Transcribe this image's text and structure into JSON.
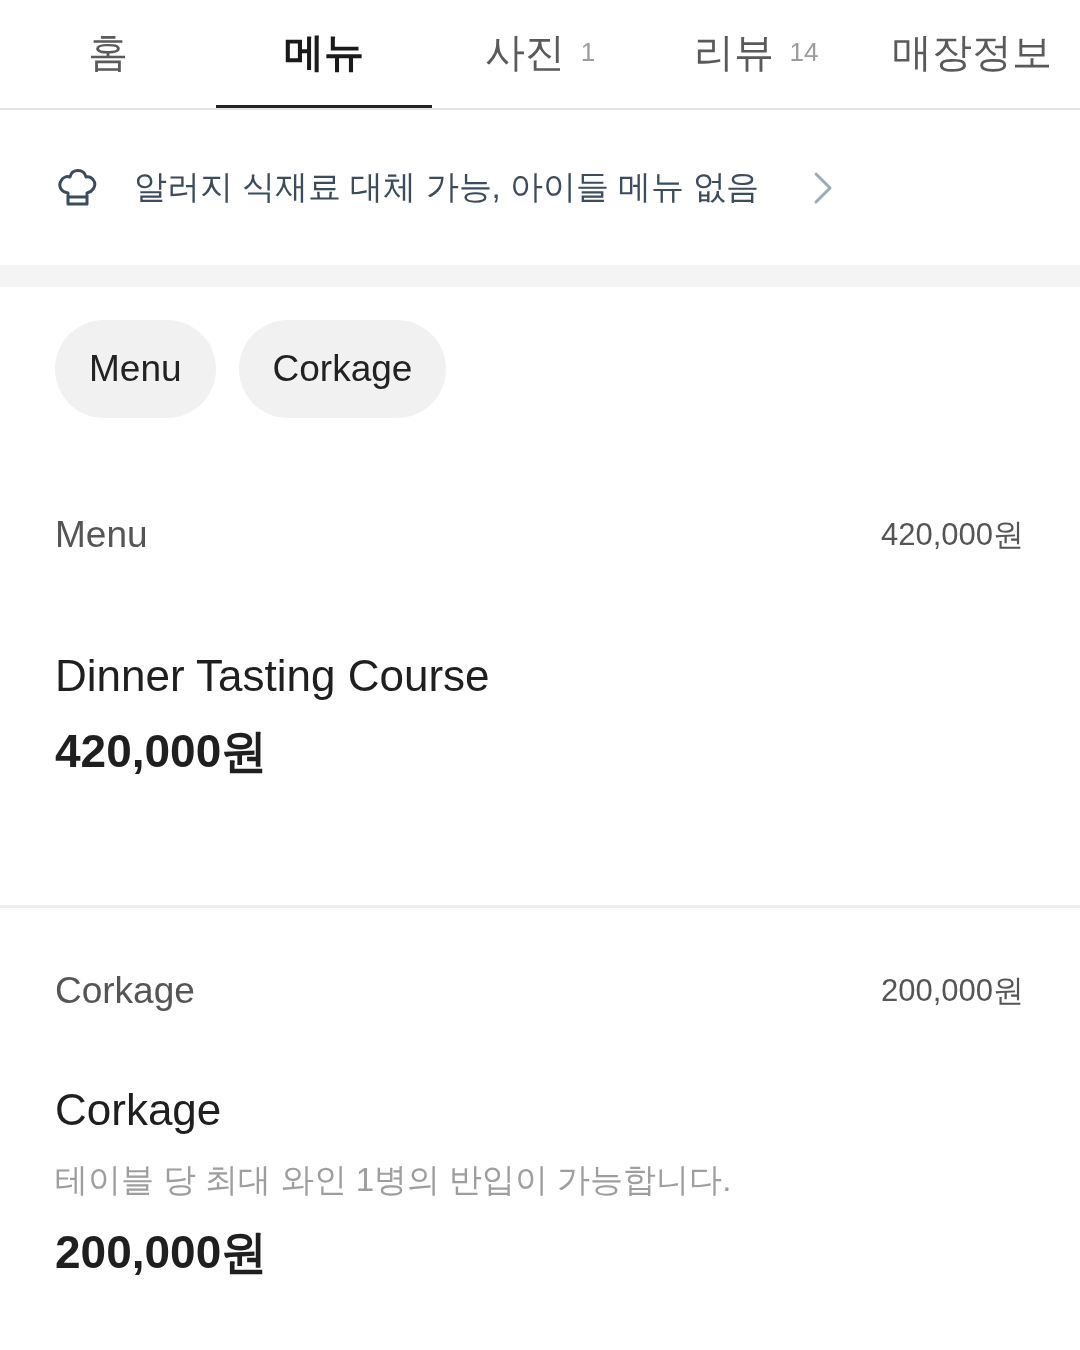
{
  "tabs": [
    {
      "label": "홈",
      "selected": false
    },
    {
      "label": "메뉴",
      "selected": true
    },
    {
      "label": "사진",
      "count": "1",
      "selected": false
    },
    {
      "label": "리뷰",
      "count": "14",
      "selected": false
    },
    {
      "label": "매장정보",
      "selected": false
    }
  ],
  "notice": {
    "text": "알러지 식재료 대체 가능, 아이들 메뉴 없음"
  },
  "chips": [
    {
      "label": "Menu"
    },
    {
      "label": "Corkage"
    }
  ],
  "sections": [
    {
      "title": "Menu",
      "price": "420,000원",
      "items": [
        {
          "name": "Dinner Tasting Course",
          "price": "420,000원"
        }
      ]
    },
    {
      "title": "Corkage",
      "price": "200,000원",
      "items": [
        {
          "name": "Corkage",
          "description": "테이블 당 최대 와인 1병의 반입이 가능합니다.",
          "price": "200,000원"
        }
      ]
    }
  ]
}
